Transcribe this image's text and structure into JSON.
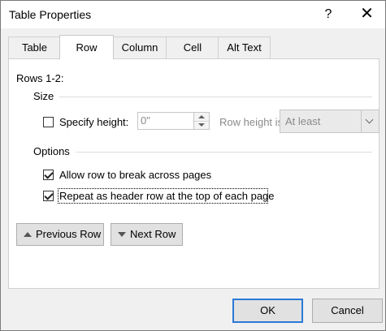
{
  "window": {
    "title": "Table Properties",
    "help_glyph": "?",
    "close_glyph": "✕"
  },
  "tabs": [
    {
      "label": "Table",
      "active": false
    },
    {
      "label": "Row",
      "active": true
    },
    {
      "label": "Column",
      "active": false
    },
    {
      "label": "Cell",
      "active": false
    },
    {
      "label": "Alt Text",
      "active": false
    }
  ],
  "row_tab": {
    "rows_label": "Rows 1-2:",
    "size_group": "Size",
    "specify_height": {
      "label": "Specify height:",
      "checked": false
    },
    "height_value": "0\"",
    "row_height_is_label": "Row height is:",
    "row_height_is_value": "At least",
    "options_group": "Options",
    "allow_break": {
      "label": "Allow row to break across pages",
      "checked": true
    },
    "repeat_header": {
      "label": "Repeat as header row at the top of each page",
      "checked": true
    },
    "previous_row": "Previous Row",
    "next_row": "Next Row"
  },
  "footer": {
    "ok": "OK",
    "cancel": "Cancel"
  },
  "colors": {
    "dialog_bg": "#f0f0f0",
    "panel_bg": "#ffffff",
    "default_button_border": "#2b79d7"
  }
}
